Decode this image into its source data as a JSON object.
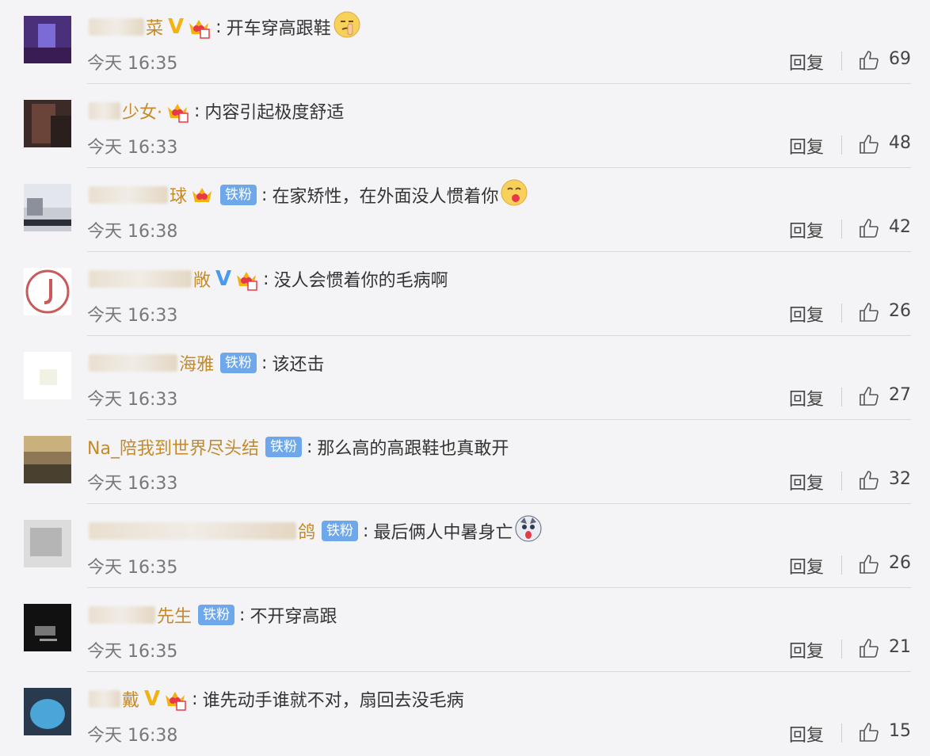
{
  "comments": [
    {
      "name_visible": "菜",
      "badge": "V",
      "badge_color": "gold",
      "fan_label": "",
      "text": "开车穿高跟鞋",
      "emoji": "shh-emoji",
      "time": "今天 16:35",
      "reply": "回复",
      "likes": "69"
    },
    {
      "name_visible": "少女·",
      "badge": "",
      "badge_color": "",
      "fan_label": "",
      "text": "内容引起极度舒适",
      "emoji": "",
      "time": "今天 16:33",
      "reply": "回复",
      "likes": "48"
    },
    {
      "name_visible": "球",
      "badge": "",
      "badge_color": "",
      "fan_label": "铁粉",
      "text": "在家矫性，在外面没人惯着你",
      "emoji": "yum-emoji",
      "time": "今天 16:38",
      "reply": "回复",
      "likes": "42"
    },
    {
      "name_visible": "敞",
      "badge": "V",
      "badge_color": "blue",
      "fan_label": "",
      "text": "没人会惯着你的毛病啊",
      "emoji": "",
      "time": "今天 16:33",
      "reply": "回复",
      "likes": "26"
    },
    {
      "name_visible": "海雅",
      "badge": "",
      "badge_color": "",
      "fan_label": "铁粉",
      "text": "该还击",
      "emoji": "",
      "time": "今天 16:33",
      "reply": "回复",
      "likes": "27"
    },
    {
      "name_visible": "Na_陪我到世界尽头结",
      "badge": "",
      "badge_color": "",
      "fan_label": "铁粉",
      "text": "那么高的高跟鞋也真敢开",
      "emoji": "",
      "time": "今天 16:33",
      "reply": "回复",
      "likes": "32"
    },
    {
      "name_visible": "鸽",
      "badge": "",
      "badge_color": "",
      "fan_label": "铁粉",
      "text": "最后俩人中暑身亡",
      "emoji": "husky-emoji",
      "time": "今天 16:35",
      "reply": "回复",
      "likes": "26"
    },
    {
      "name_visible": "先生",
      "badge": "",
      "badge_color": "",
      "fan_label": "铁粉",
      "text": "不开穿高跟",
      "emoji": "",
      "time": "今天 16:35",
      "reply": "回复",
      "likes": "21"
    },
    {
      "name_visible": "戴",
      "badge": "V",
      "badge_color": "gold",
      "fan_label": "",
      "text": "谁先动手谁就不对，扇回去没毛病",
      "emoji": "",
      "time": "今天 16:38",
      "reply": "回复",
      "likes": "15"
    }
  ],
  "colors": {
    "username": "#c58a2a",
    "fan_badge": "#6ea8ea",
    "v_gold": "#f3b210",
    "v_blue": "#4a9af0",
    "background": "#f4f4f6"
  }
}
